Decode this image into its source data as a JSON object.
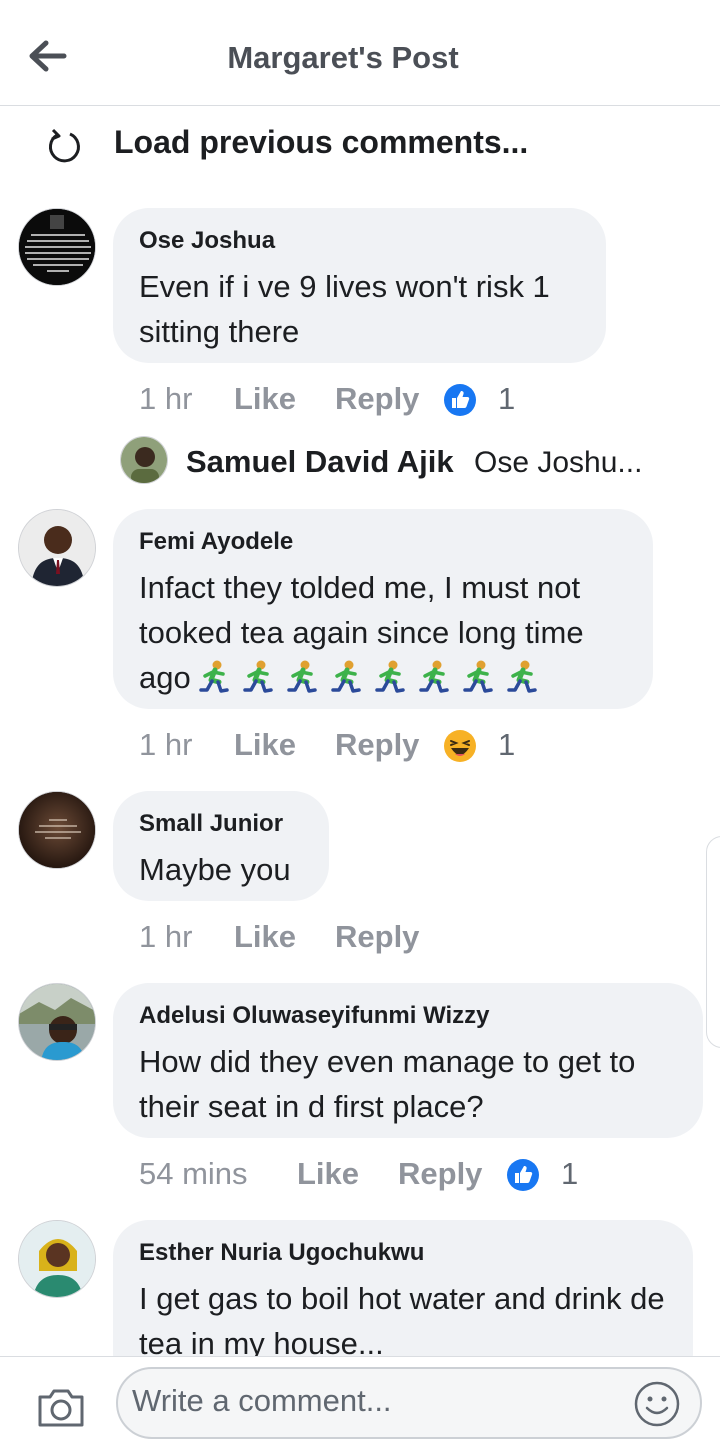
{
  "header": {
    "title": "Margaret's Post",
    "back_icon": "arrow-left-icon"
  },
  "load_previous": {
    "label": "Load previous comments...",
    "icon": "refresh-icon"
  },
  "comments": [
    {
      "name": "Ose Joshua",
      "text": "Even if i ve 9 lives won't risk 1 sitting there",
      "time": "1 hr",
      "like": "Like",
      "reply": "Reply",
      "reaction": "like-reaction-icon",
      "count": "1"
    },
    {
      "name": "Femi Ayodele",
      "text": "Infact they tolded me, I must not tooked tea again since long time ago",
      "emojis": "running-person-emoji x8",
      "time": "1 hr",
      "like": "Like",
      "reply": "Reply",
      "reaction": "haha-reaction-icon",
      "count": "1"
    },
    {
      "name": "Small Junior",
      "text": "Maybe you",
      "time": "1 hr",
      "like": "Like",
      "reply": "Reply"
    },
    {
      "name": "Adelusi Oluwaseyifunmi Wizzy",
      "text": "How did they even manage to get to their seat in d first place?",
      "time": "54 mins",
      "like": "Like",
      "reply": "Reply",
      "reaction": "like-reaction-icon",
      "count": "1"
    },
    {
      "name": "Esther Nuria Ugochukwu",
      "text": "I get gas to boil hot water and drink de tea in my house..."
    }
  ],
  "reply_preview": {
    "name": "Samuel David Ajik",
    "preview": "Ose Joshu..."
  },
  "composer": {
    "placeholder": "Write a comment...",
    "camera_icon": "camera-icon",
    "emoji_icon": "smiley-icon"
  },
  "colors": {
    "bubble": "#f0f2f5",
    "like_blue": "#1877f2",
    "haha_yellow": "#f7b125",
    "muted": "#90949c"
  }
}
